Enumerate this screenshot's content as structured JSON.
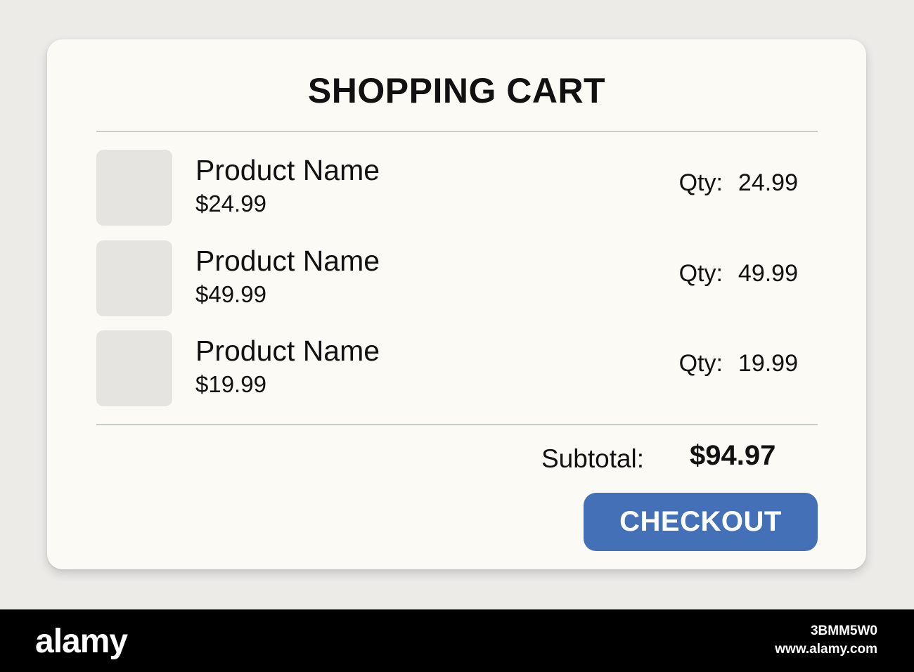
{
  "cart": {
    "title": "SHOPPING CART",
    "items": [
      {
        "name": "Product Name",
        "price": "$24.99",
        "qty_label": "Qty:",
        "qty_value": "24.99"
      },
      {
        "name": "Product Name",
        "price": "$49.99",
        "qty_label": "Qty:",
        "qty_value": "49.99"
      },
      {
        "name": "Product Name",
        "price": "$19.99",
        "qty_label": "Qty:",
        "qty_value": "19.99"
      }
    ],
    "subtotal_label": "Subtotal:",
    "subtotal_value": "$94.97",
    "checkout_label": "CHECKOUT"
  },
  "footer": {
    "logo": "alamy",
    "image_id": "3BMM5W0",
    "site": "www.alamy.com"
  },
  "colors": {
    "background": "#edebe8",
    "card": "#fcfaf4",
    "thumbnail": "#e6e4e1",
    "divider": "#c9cec5",
    "checkout_button": "#4370b7",
    "footer": "#000000"
  }
}
